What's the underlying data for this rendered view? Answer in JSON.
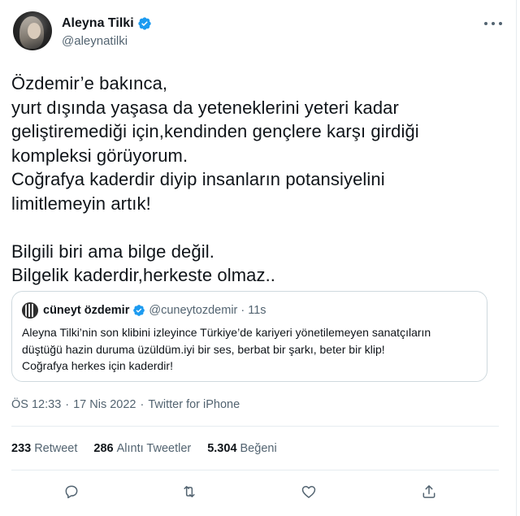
{
  "author": {
    "display_name": "Aleyna Tilki",
    "handle": "@aleynatilki"
  },
  "tweet": {
    "text": "Özdemir’e bakınca,\nyurt dışında yaşasa da yeteneklerini yeteri kadar\ngeliştiremediği için,kendinden gençlere karşı girdiği\nkompleksi görüyorum.\nCoğrafya kaderdir diyip insanların potansiyelini\nlimitlemeyin artık!\n\nBilgili biri ama bilge değil.\nBilgelik kaderdir,herkeste olmaz.."
  },
  "quoted": {
    "display_name": "cüneyt özdemir",
    "handle": "@cuneytozdemir",
    "dot": "·",
    "time": "11s",
    "text": "Aleyna Tilki’nin son klibini izleyince Türkiye’de kariyeri yönetilemeyen sanatçıların\ndüştüğü hazin duruma üzüldüm.iyi bir ses, berbat bir şarkı, beter bir klip!\nCoğrafya herkes için kaderdir!"
  },
  "meta": {
    "time": "ÖS 12:33",
    "sep1": "·",
    "date": "17 Nis 2022",
    "sep2": "·",
    "source": "Twitter for iPhone"
  },
  "stats": {
    "retweets": {
      "value": "233",
      "label": "Retweet"
    },
    "quotes": {
      "value": "286",
      "label": "Alıntı Tweetler"
    },
    "likes": {
      "value": "5.304",
      "label": "Beğeni"
    }
  },
  "icons": {
    "verified": "verified-badge-icon",
    "more": "more-options-icon",
    "reply": "reply-icon",
    "retweet": "retweet-icon",
    "like": "heart-icon",
    "share": "share-icon"
  },
  "colors": {
    "verified_blue": "#1d9bf0",
    "text_primary": "#0f1419",
    "text_secondary": "#536471",
    "border": "#cfd9de"
  }
}
